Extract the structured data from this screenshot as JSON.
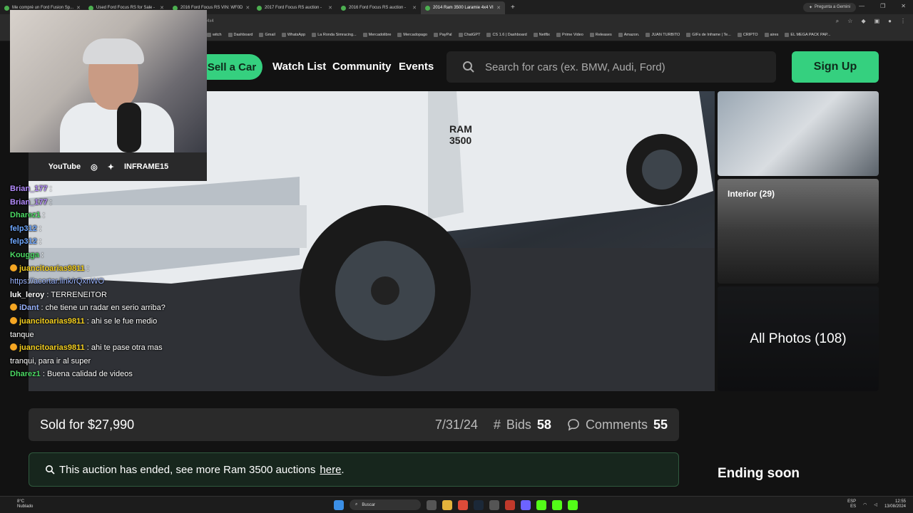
{
  "browser": {
    "tabs": [
      {
        "title": "Me compré un Ford Fusion Sp...",
        "active": false
      },
      {
        "title": "Used Ford Focus RS for Sale -",
        "active": false
      },
      {
        "title": "2016 Ford Focus RS VIN: WF0D",
        "active": false
      },
      {
        "title": "2017 Ford Focus RS auction -",
        "active": false
      },
      {
        "title": "2016 Ford Focus RS auction -",
        "active": false
      },
      {
        "title": "2014 Ram 3500 Laramie 4x4 VI",
        "active": true
      }
    ],
    "new_tab": "+",
    "gemini_label": "Pregunta a Gemini",
    "url_fragment": "4x4",
    "bookmarks": [
      "witch",
      "Dashboard",
      "Gmail",
      "WhatsApp",
      "La Ronda Simracing...",
      "Mercadolibre",
      "Mercadopago",
      "PayPal",
      "ChatGPT",
      "CS 1.6 | Dashboard",
      "Netflix",
      "Prime Video",
      "Releases",
      "Amazon.",
      "JUAN TURBITO",
      "GIFs de Inframe | Te...",
      "CRIPTO",
      "aires",
      "EL MEGA PACK PAP..."
    ]
  },
  "site": {
    "nav": {
      "sell": "Sell a Car",
      "watch": "Watch List",
      "community": "Community",
      "events": "Events",
      "search_placeholder": "Search for cars (ex. BMW, Audi, Ford)",
      "signup": "Sign Up"
    },
    "hero": {
      "badge_ram": "RAM",
      "badge_model": "3500"
    },
    "thumbs": {
      "interior": "Interior (29)",
      "all_photos": "All Photos (108)"
    },
    "sold": {
      "text": "Sold for $27,990",
      "date": "7/31/24",
      "bids_label": "Bids",
      "bids_value": "58",
      "comments_label": "Comments",
      "comments_value": "55"
    },
    "ended": {
      "text": "This auction has ended, see more Ram 3500 auctions",
      "link": "here",
      "period": "."
    },
    "ending_soon": "Ending soon"
  },
  "stream": {
    "youtube": "YouTube",
    "handle": "INFRAME15",
    "chat": [
      {
        "user": "Brian_177",
        "msg": ""
      },
      {
        "user": "Brian_177",
        "msg": ""
      },
      {
        "user": "Dharez1",
        "msg": ""
      },
      {
        "user": "felp312",
        "msg": ""
      },
      {
        "user": "felp312",
        "msg": ""
      },
      {
        "user": "Kougga",
        "msg": ""
      },
      {
        "user": "juancitoarias9811",
        "msg": "https://acortar.link/rQxnWO"
      },
      {
        "user": "luk_leroy",
        "msg": "TERRENEITOR"
      },
      {
        "user": "iDant",
        "msg": "che tiene un radar en serio arriba?"
      },
      {
        "user": "juancitoarias9811",
        "msg": "ahi se le fue medio tanque"
      },
      {
        "user": "juancitoarias9811",
        "msg": "ahi te pase otra mas tranqui, para ir al super"
      },
      {
        "user": "Dharez1",
        "msg": "Buena calidad de videos"
      }
    ]
  },
  "taskbar": {
    "weather_temp": "8°C",
    "weather_desc": "Nublado",
    "search": "Buscar",
    "lang": "ESP",
    "region": "ES",
    "time": "12:55",
    "date": "13/08/2024"
  }
}
